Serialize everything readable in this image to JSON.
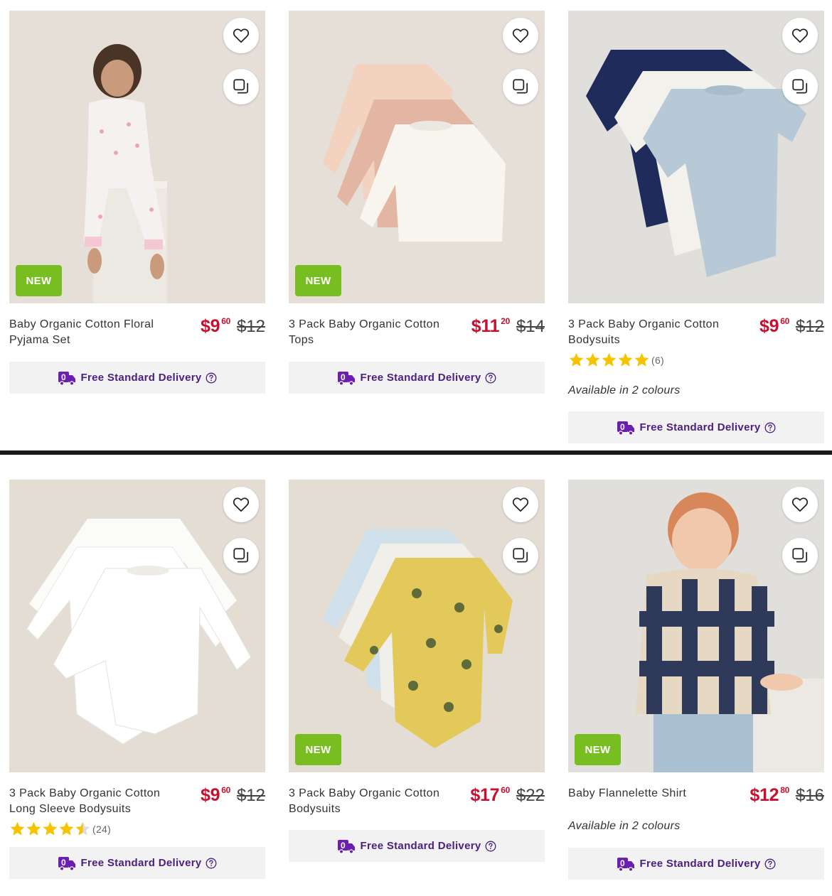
{
  "colors": {
    "price": "#c8102e",
    "badge_new": "#78be20",
    "delivery_text": "#4b1f7e",
    "star": "#f5c400"
  },
  "products": [
    {
      "name": "Baby Organic Cotton Floral Pyjama Set",
      "price_main": "$9",
      "price_cents": "60",
      "was_price": "$12",
      "badge": "NEW",
      "delivery": "Free Standard Delivery"
    },
    {
      "name": "3 Pack Baby Organic Cotton Tops",
      "price_main": "$11",
      "price_cents": "20",
      "was_price": "$14",
      "badge": "NEW",
      "delivery": "Free Standard Delivery"
    },
    {
      "name": "3 Pack Baby Organic Cotton Bodysuits",
      "price_main": "$9",
      "price_cents": "60",
      "was_price": "$12",
      "rating": 5,
      "reviews": "(6)",
      "availability": "Available in 2 colours",
      "delivery": "Free Standard Delivery"
    },
    {
      "name": "3 Pack Baby Organic Cotton Long Sleeve Bodysuits",
      "price_main": "$9",
      "price_cents": "60",
      "was_price": "$12",
      "rating": 4.5,
      "reviews": "(24)",
      "delivery": "Free Standard Delivery"
    },
    {
      "name": "3 Pack Baby Organic Cotton Bodysuits",
      "price_main": "$17",
      "price_cents": "60",
      "was_price": "$22",
      "badge": "NEW",
      "delivery": "Free Standard Delivery"
    },
    {
      "name": "Baby Flannelette Shirt",
      "price_main": "$12",
      "price_cents": "80",
      "was_price": "$16",
      "badge": "NEW",
      "availability": "Available in 2 colours",
      "delivery": "Free Standard Delivery"
    }
  ]
}
